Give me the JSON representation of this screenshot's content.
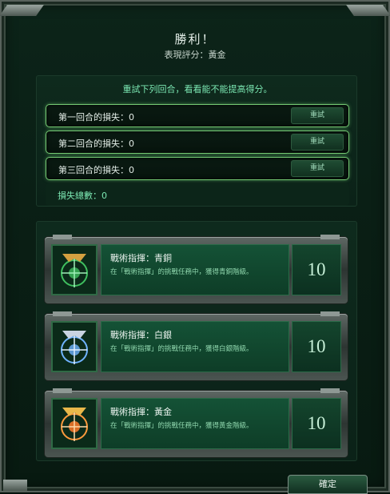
{
  "header": {
    "title": "勝利！",
    "subtitle": "表現評分：黃金"
  },
  "rounds_panel": {
    "hint": "重試下列回合，看看能不能提高得分。",
    "rounds": [
      {
        "label": "第一回合的損失：0",
        "button": "重試"
      },
      {
        "label": "第二回合的損失：0",
        "button": "重試"
      },
      {
        "label": "第三回合的損失：0",
        "button": "重試"
      }
    ],
    "total": "損失總數：0"
  },
  "medals": [
    {
      "title": "戰術指揮：青銅",
      "desc": "在「戰術指揮」的挑戰任務中，獲得青銅階級。",
      "count": "10",
      "icon": "bronze-medal-icon",
      "color": "#3fbf5f"
    },
    {
      "title": "戰術指揮：白銀",
      "desc": "在「戰術指揮」的挑戰任務中，獲得白銀階級。",
      "count": "10",
      "icon": "silver-medal-icon",
      "color": "#6fb3ff"
    },
    {
      "title": "戰術指揮：黃金",
      "desc": "在「戰術指揮」的挑戰任務中，獲得黃金階級。",
      "count": "10",
      "icon": "gold-medal-icon",
      "color": "#ff9a3c"
    }
  ],
  "footer": {
    "ok_button": "確定"
  }
}
